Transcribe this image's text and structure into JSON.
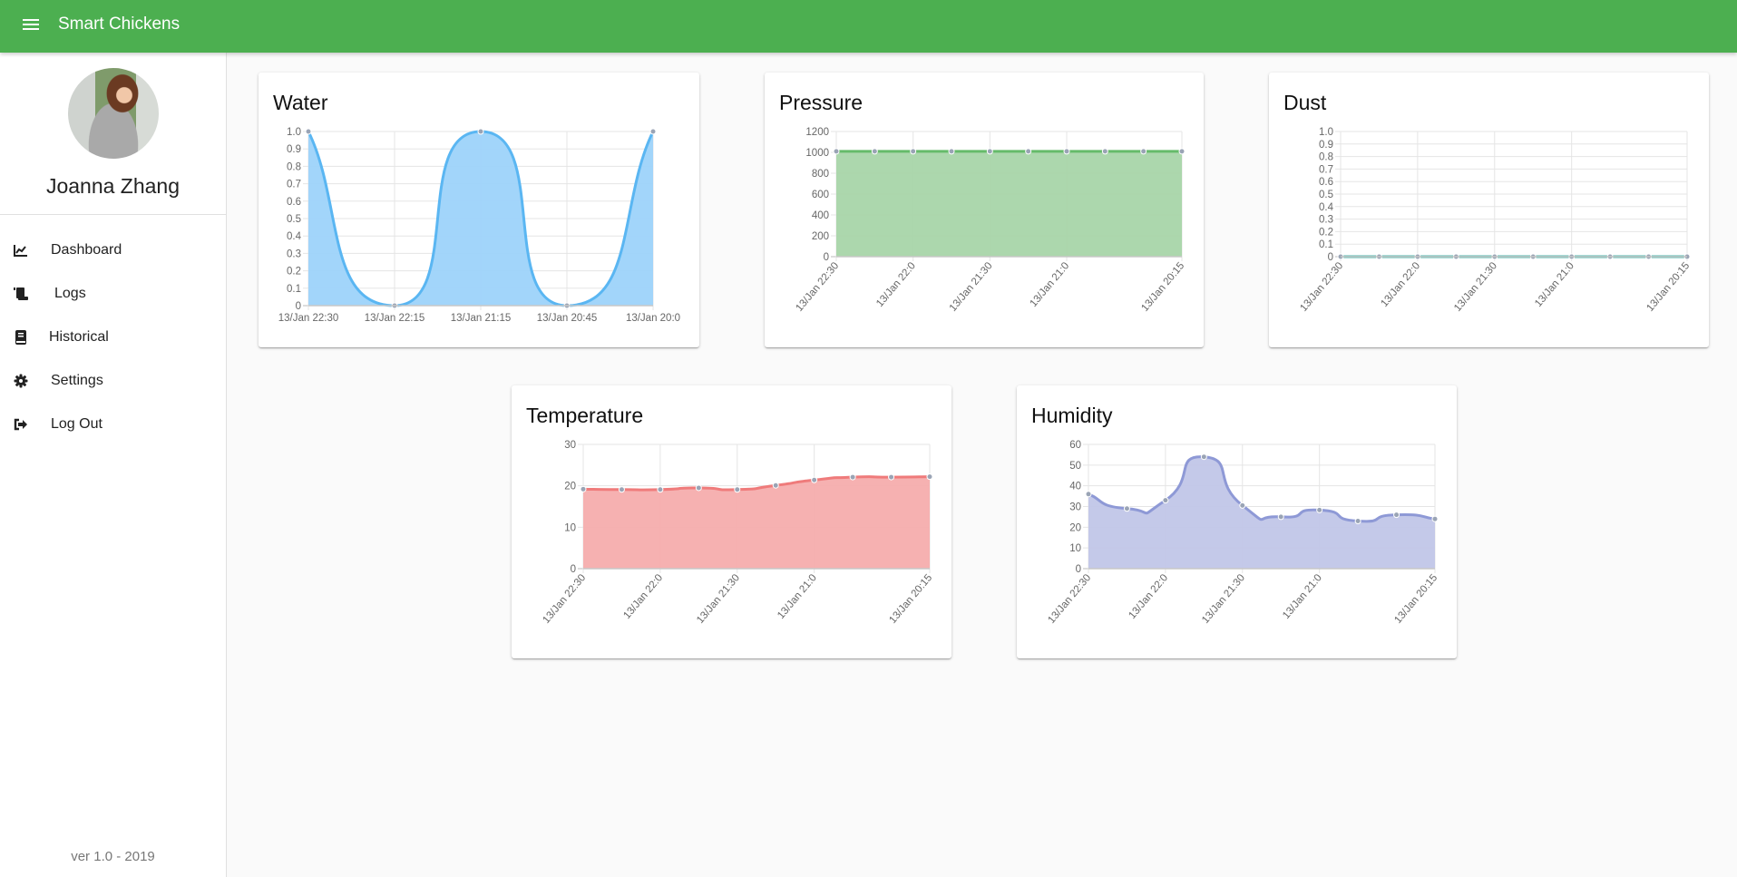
{
  "header": {
    "title": "Smart Chickens",
    "menu_icon": "hamburger-menu-icon",
    "color": "#4CAF50"
  },
  "sidebar": {
    "user_name": "Joanna Zhang",
    "avatar_icon": "user-avatar-photo",
    "items": [
      {
        "label": "Dashboard",
        "icon": "area-chart-icon"
      },
      {
        "label": "Logs",
        "icon": "scroll-icon"
      },
      {
        "label": "Historical",
        "icon": "book-icon"
      },
      {
        "label": "Settings",
        "icon": "gear-icon"
      },
      {
        "label": "Log Out",
        "icon": "sign-out-icon"
      }
    ],
    "version": "ver 1.0 - 2019"
  },
  "chart_data": [
    {
      "id": "water",
      "type": "area",
      "title": "Water",
      "x": [
        "13/Jan 22:30",
        "13/Jan 22:15",
        "13/Jan 21:15",
        "13/Jan 20:45",
        "13/Jan 20:0"
      ],
      "xtick_labels": [
        "13/Jan 22:30",
        "13/Jan 22:15",
        "13/Jan 21:15",
        "13/Jan 20:45",
        "13/Jan 20:0"
      ],
      "xtick_rotation": 0,
      "series": [
        {
          "name": "Water",
          "values": [
            1,
            0,
            1,
            0,
            1
          ]
        }
      ],
      "ylim": [
        0,
        1
      ],
      "yticks": [
        "0",
        "0.1",
        "0.2",
        "0.3",
        "0.4",
        "0.5",
        "0.6",
        "0.7",
        "0.8",
        "0.9",
        "1.0"
      ],
      "line_color": "#5AB6F2",
      "fill_color": "#9DD3FA",
      "grid": true,
      "xlabel": "",
      "ylabel": ""
    },
    {
      "id": "pressure",
      "type": "area",
      "title": "Pressure",
      "x": [
        "13/Jan 22:30",
        "",
        "13/Jan 22:0",
        "",
        "13/Jan 21:30",
        "",
        "13/Jan 21:0",
        "",
        "",
        "13/Jan 20:15"
      ],
      "xtick_labels": [
        "13/Jan 22:30",
        "13/Jan 22:0",
        "13/Jan 21:30",
        "13/Jan 21:0",
        "13/Jan 20:15"
      ],
      "xtick_rotation": -50,
      "series": [
        {
          "name": "Pressure",
          "values": [
            1010,
            1010,
            1010,
            1010,
            1010,
            1010,
            1010,
            1010,
            1010,
            1010
          ]
        }
      ],
      "ylim": [
        0,
        1200
      ],
      "yticks": [
        "0",
        "200",
        "400",
        "600",
        "800",
        "1000",
        "1200"
      ],
      "line_color": "#66BB6A",
      "fill_color": "#A8D5A9",
      "grid": true,
      "xlabel": "",
      "ylabel": ""
    },
    {
      "id": "dust",
      "type": "area",
      "title": "Dust",
      "x": [
        "13/Jan 22:30",
        "",
        "13/Jan 22:0",
        "",
        "13/Jan 21:30",
        "",
        "13/Jan 21:0",
        "",
        "",
        "13/Jan 20:15"
      ],
      "xtick_labels": [
        "13/Jan 22:30",
        "13/Jan 22:0",
        "13/Jan 21:30",
        "13/Jan 21:0",
        "13/Jan 20:15"
      ],
      "xtick_rotation": -50,
      "series": [
        {
          "name": "Dust",
          "values": [
            0,
            0,
            0,
            0,
            0,
            0,
            0,
            0,
            0,
            0
          ]
        }
      ],
      "ylim": [
        0,
        1
      ],
      "yticks": [
        "0",
        "0.1",
        "0.2",
        "0.3",
        "0.4",
        "0.5",
        "0.6",
        "0.7",
        "0.8",
        "0.9",
        "1.0"
      ],
      "line_color": "#4DB6AC",
      "fill_color": "#B2DFDB",
      "grid": true,
      "xlabel": "",
      "ylabel": ""
    },
    {
      "id": "temperature",
      "type": "area",
      "title": "Temperature",
      "x": [
        "13/Jan 22:30",
        "",
        "13/Jan 22:0",
        "",
        "13/Jan 21:30",
        "",
        "13/Jan 21:0",
        "",
        "",
        "13/Jan 20:15"
      ],
      "xtick_labels": [
        "13/Jan 22:30",
        "13/Jan 22:0",
        "13/Jan 21:30",
        "13/Jan 21:0",
        "13/Jan 20:15"
      ],
      "xtick_rotation": -50,
      "series": [
        {
          "name": "Temperature",
          "values": [
            19.2,
            19.1,
            19.1,
            19.5,
            19.1,
            20.1,
            21.4,
            22.1,
            22.1,
            22.2
          ]
        }
      ],
      "ylim": [
        0,
        30
      ],
      "yticks": [
        "0",
        "10",
        "20",
        "30"
      ],
      "line_color": "#EF7B7B",
      "fill_color": "#F6ADAD",
      "grid": true,
      "xlabel": "",
      "ylabel": ""
    },
    {
      "id": "humidity",
      "type": "area",
      "title": "Humidity",
      "x": [
        "13/Jan 22:30",
        "",
        "13/Jan 22:0",
        "",
        "13/Jan 21:30",
        "",
        "13/Jan 21:0",
        "",
        "",
        "13/Jan 20:15"
      ],
      "xtick_labels": [
        "13/Jan 22:30",
        "13/Jan 22:0",
        "13/Jan 21:30",
        "13/Jan 21:0",
        "13/Jan 20:15"
      ],
      "xtick_rotation": -50,
      "series": [
        {
          "name": "Humidity",
          "values": [
            36,
            29,
            33,
            54,
            30.5,
            25,
            28.3,
            23,
            26,
            24
          ]
        }
      ],
      "ylim": [
        0,
        60
      ],
      "yticks": [
        "0",
        "10",
        "20",
        "30",
        "40",
        "50",
        "60"
      ],
      "line_color": "#8E99D6",
      "fill_color": "#C1C6E8",
      "grid": true,
      "xlabel": "",
      "ylabel": ""
    }
  ]
}
